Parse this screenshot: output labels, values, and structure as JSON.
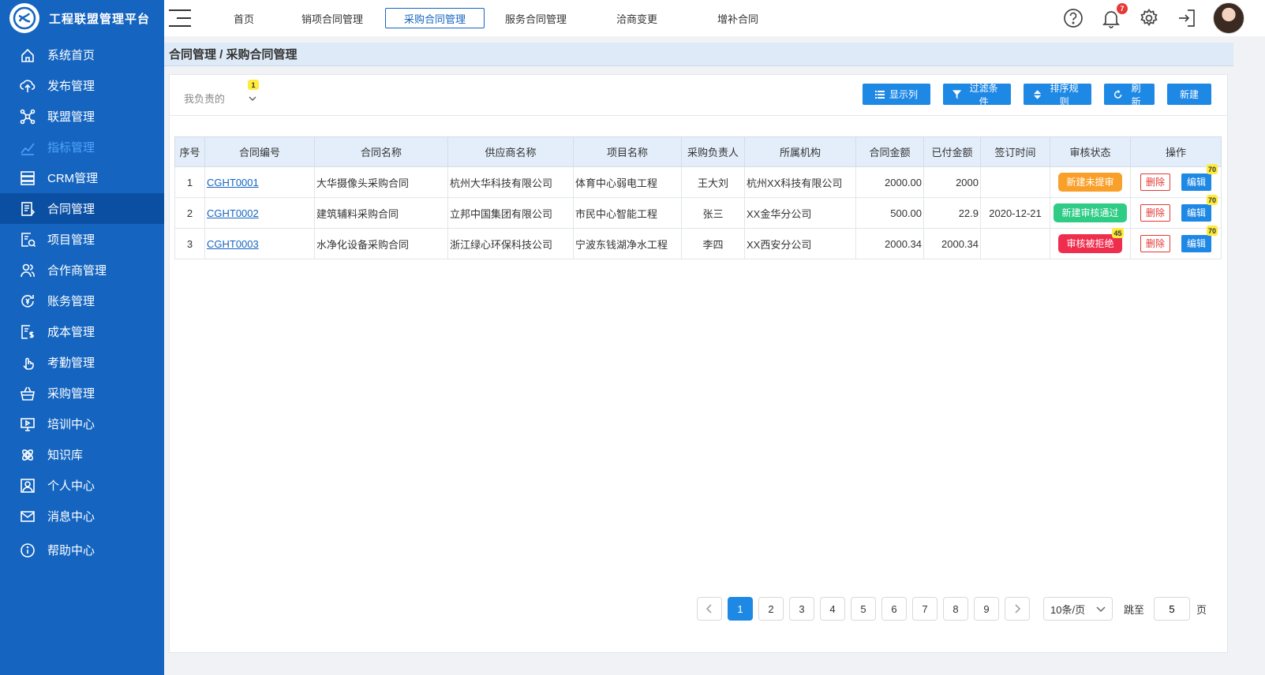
{
  "app": {
    "title": "工程联盟管理平台"
  },
  "sidebar": {
    "items": [
      {
        "label": "系统首页",
        "icon": "home-icon"
      },
      {
        "label": "发布管理",
        "icon": "upload-icon"
      },
      {
        "label": "联盟管理",
        "icon": "network-icon"
      },
      {
        "label": "指标管理",
        "icon": "chart-line-icon"
      },
      {
        "label": "CRM管理",
        "icon": "server-icon"
      },
      {
        "label": "合同管理",
        "icon": "contract-icon"
      },
      {
        "label": "项目管理",
        "icon": "project-icon"
      },
      {
        "label": "合作商管理",
        "icon": "partners-icon"
      },
      {
        "label": "账务管理",
        "icon": "finance-icon"
      },
      {
        "label": "成本管理",
        "icon": "cost-icon"
      },
      {
        "label": "考勤管理",
        "icon": "attendance-icon"
      },
      {
        "label": "采购管理",
        "icon": "basket-icon"
      },
      {
        "label": "培训中心",
        "icon": "training-icon"
      },
      {
        "label": "知识库",
        "icon": "knowledge-icon"
      },
      {
        "label": "个人中心",
        "icon": "user-icon"
      },
      {
        "label": "消息中心",
        "icon": "message-icon"
      },
      {
        "label": "帮助中心",
        "icon": "info-icon"
      }
    ]
  },
  "topnav": {
    "tabs": [
      "首页",
      "销项合同管理",
      "采购合同管理",
      "服务合同管理",
      "洽商变更",
      "增补合同"
    ],
    "active_tab": "采购合同管理",
    "notification_count": "7"
  },
  "breadcrumb": "合同管理 / 采购合同管理",
  "filter": {
    "label": "我负责的",
    "badge": "1"
  },
  "actions": {
    "columns": "显示列",
    "filter": "过滤条件",
    "sort": "排序规则",
    "refresh": "刷新",
    "create": "新建"
  },
  "table": {
    "headers": [
      "序号",
      "合同编号",
      "合同名称",
      "供应商名称",
      "项目名称",
      "采购负责人",
      "所属机构",
      "合同金额",
      "已付金额",
      "签订时间",
      "审核状态",
      "操作"
    ],
    "rows": [
      {
        "no": "1",
        "code": "CGHT0001",
        "name": "大华摄像头采购合同",
        "supplier": "杭州大华科技有限公司",
        "project": "体育中心弱电工程",
        "owner": "王大刘",
        "org": "杭州XX科技有限公司",
        "amount": "2000.00",
        "paid": "2000",
        "date": "",
        "status": "新建未提审",
        "status_color": "#f9a02b",
        "status_badge": "",
        "edit_badge": "70"
      },
      {
        "no": "2",
        "code": "CGHT0002",
        "name": "建筑辅料采购合同",
        "supplier": "立邦中国集团有限公司",
        "project": "市民中心智能工程",
        "owner": "张三",
        "org": "XX金华分公司",
        "amount": "500.00",
        "paid": "22.9",
        "date": "2020-12-21",
        "status": "新建审核通过",
        "status_color": "#2fcc85",
        "status_badge": "",
        "edit_badge": "70"
      },
      {
        "no": "3",
        "code": "CGHT0003",
        "name": "水净化设备采购合同",
        "supplier": "浙江绿心环保科技公司",
        "project": "宁波东钱湖净水工程",
        "owner": "李四",
        "org": "XX西安分公司",
        "amount": "2000.34",
        "paid": "2000.34",
        "date": "",
        "status": "审核被拒绝",
        "status_color": "#ef2d4d",
        "status_badge": "45",
        "edit_badge": "70"
      }
    ],
    "delete_label": "删除",
    "edit_label": "编辑"
  },
  "pagination": {
    "pages": [
      "1",
      "2",
      "3",
      "4",
      "5",
      "6",
      "7",
      "8",
      "9"
    ],
    "current": "1",
    "page_size": "10条/页",
    "jump_label": "跳至",
    "jump_value": "5",
    "page_suffix": "页"
  }
}
